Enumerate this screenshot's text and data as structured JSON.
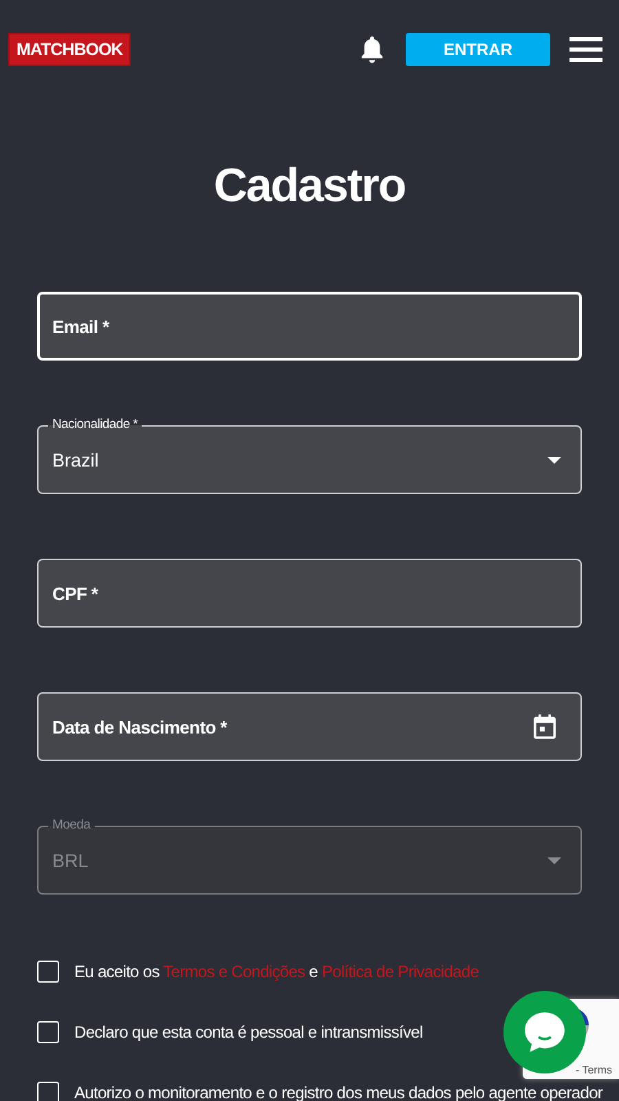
{
  "header": {
    "logo": "MATCHBOOK",
    "login_button": "ENTRAR"
  },
  "title": "Cadastro",
  "fields": [
    {
      "kind": "text",
      "label": "Email *",
      "focused": true,
      "disabled": false
    },
    {
      "kind": "select",
      "label": "Nacionalidade *",
      "value": "Brazil",
      "focused": false,
      "disabled": false
    },
    {
      "kind": "text",
      "label": "CPF *",
      "focused": false,
      "disabled": false
    },
    {
      "kind": "date",
      "label": "Data de Nascimento *",
      "focused": false,
      "disabled": false
    },
    {
      "kind": "select",
      "label": "Moeda",
      "value": "BRL",
      "focused": false,
      "disabled": true
    }
  ],
  "agreements": [
    {
      "checked": false,
      "segments": [
        {
          "kind": "text",
          "text": "Eu aceito os "
        },
        {
          "kind": "link",
          "text": "Termos e Condições"
        },
        {
          "kind": "text",
          "text": " e "
        },
        {
          "kind": "link",
          "text": "Política de Privacidade"
        }
      ]
    },
    {
      "checked": false,
      "segments": [
        {
          "kind": "text",
          "text": "Declaro que esta conta é pessoal e intransmissível"
        }
      ]
    },
    {
      "checked": false,
      "segments": [
        {
          "kind": "text",
          "text": "Autorizo o monitoramento e o registro dos meus dados pelo agente operador"
        }
      ]
    }
  ],
  "recaptcha": {
    "links": "- Terms"
  }
}
